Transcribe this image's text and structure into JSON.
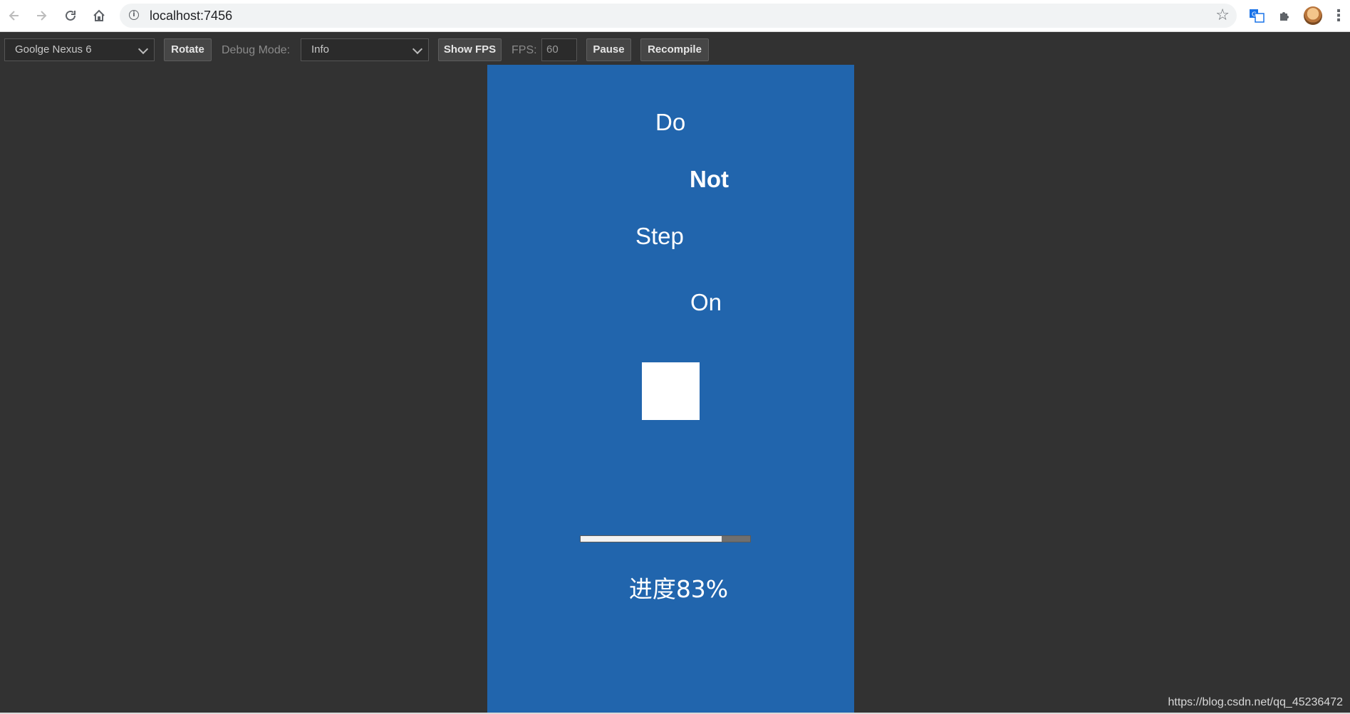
{
  "browser": {
    "url": "localhost:7456"
  },
  "icons": {
    "back": "arrow-left-icon",
    "forward": "arrow-right-icon",
    "reload": "reload-icon",
    "home": "home-icon",
    "info": "info-icon",
    "star": "star-icon",
    "translate": "translate-icon",
    "extensions": "puzzle-icon",
    "profile": "avatar",
    "menu": "kebab-menu-icon"
  },
  "toolbar": {
    "device": "Goolge Nexus 6",
    "rotate_label": "Rotate",
    "debug_mode_label": "Debug Mode:",
    "debug_mode_value": "Info",
    "show_fps_label": "Show FPS",
    "fps_label": "FPS:",
    "fps_value": "60",
    "pause_label": "Pause",
    "recompile_label": "Recompile"
  },
  "scene": {
    "words": [
      "Do",
      "Not",
      "Step",
      "On"
    ],
    "progress_value": 0.83,
    "progress_label": "进度83%"
  },
  "watermark": "https://blog.csdn.net/qq_45236472",
  "colors": {
    "canvas_bg": "#2165ad",
    "page_bg": "#323232"
  }
}
